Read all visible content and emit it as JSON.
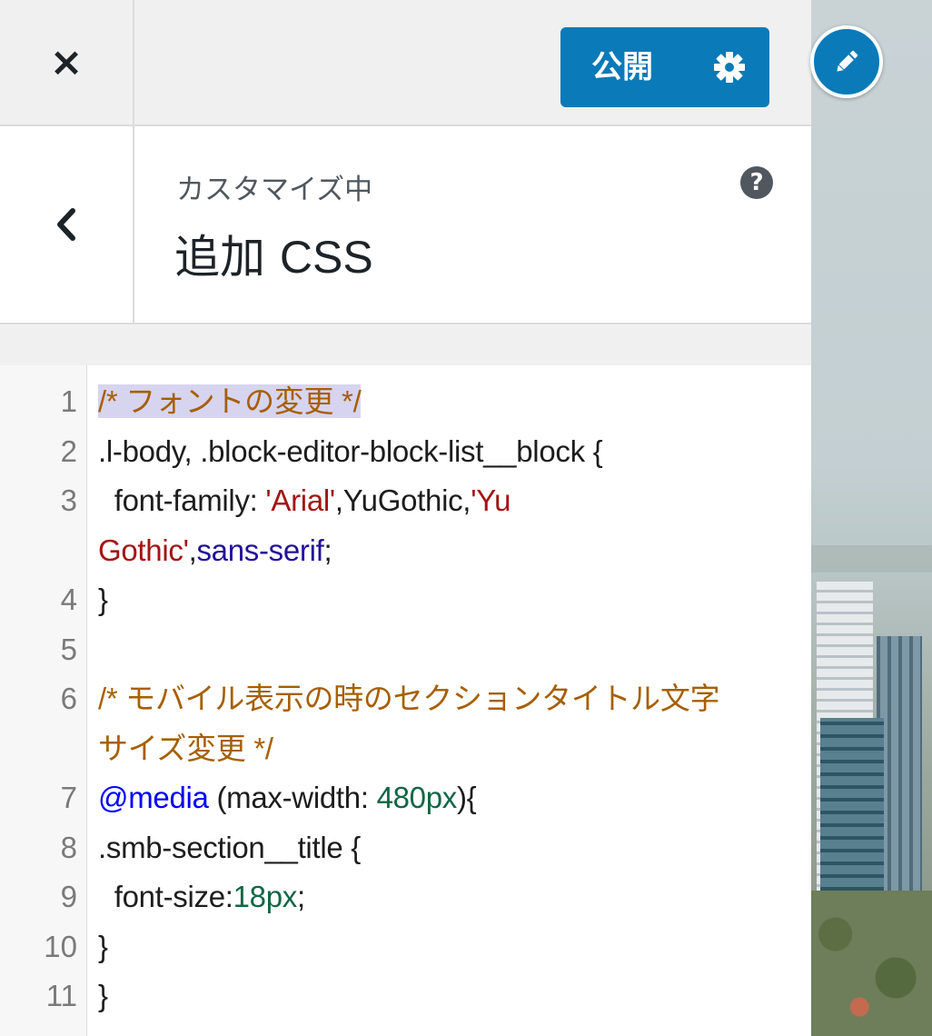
{
  "topbar": {
    "close_icon": "×",
    "publish_label": "公開"
  },
  "header": {
    "customizing_label": "カスタマイズ中",
    "title_jp": "追加",
    "title_en": "CSS",
    "help_icon": "?"
  },
  "editor": {
    "lines": [
      {
        "n": "1",
        "segments": [
          {
            "t": "/* フォントの変更 */",
            "cls": "c-comment hl"
          }
        ]
      },
      {
        "n": "2",
        "segments": [
          {
            "t": ".l-body, .block-editor-block-list__block {",
            "cls": ""
          }
        ]
      },
      {
        "n": "3",
        "segments": [
          {
            "t": "  font-family: ",
            "cls": ""
          },
          {
            "t": "'Arial'",
            "cls": "c-string"
          },
          {
            "t": ",YuGothic,",
            "cls": ""
          },
          {
            "t": "'Yu",
            "cls": "c-string"
          }
        ]
      },
      {
        "n": "",
        "segments": [
          {
            "t": "Gothic'",
            "cls": "c-string"
          },
          {
            "t": ",",
            "cls": ""
          },
          {
            "t": "sans-serif",
            "cls": "c-atom"
          },
          {
            "t": ";",
            "cls": ""
          }
        ]
      },
      {
        "n": "4",
        "segments": [
          {
            "t": "}",
            "cls": ""
          }
        ]
      },
      {
        "n": "5",
        "segments": [
          {
            "t": "",
            "cls": ""
          }
        ]
      },
      {
        "n": "6",
        "segments": [
          {
            "t": "/* モバイル表示の時のセクションタイトル文字",
            "cls": "c-comment"
          }
        ]
      },
      {
        "n": "",
        "segments": [
          {
            "t": "サイズ変更 */",
            "cls": "c-comment"
          }
        ]
      },
      {
        "n": "7",
        "segments": [
          {
            "t": "@media",
            "cls": "c-def"
          },
          {
            "t": " (max-width: ",
            "cls": ""
          },
          {
            "t": "480px",
            "cls": "c-number"
          },
          {
            "t": "){",
            "cls": ""
          }
        ]
      },
      {
        "n": "8",
        "segments": [
          {
            "t": ".smb-section__title {",
            "cls": ""
          }
        ]
      },
      {
        "n": "9",
        "segments": [
          {
            "t": "  font-size:",
            "cls": ""
          },
          {
            "t": "18px",
            "cls": "c-number"
          },
          {
            "t": ";",
            "cls": ""
          }
        ]
      },
      {
        "n": "10",
        "segments": [
          {
            "t": "}",
            "cls": ""
          }
        ]
      },
      {
        "n": "11",
        "segments": [
          {
            "t": "}",
            "cls": ""
          }
        ]
      }
    ]
  },
  "colors": {
    "accent": "#0a7ab8",
    "comment": "#a65f00",
    "string": "#a31515",
    "keyword": "#221199",
    "def": "#0000ff",
    "number": "#116644"
  }
}
